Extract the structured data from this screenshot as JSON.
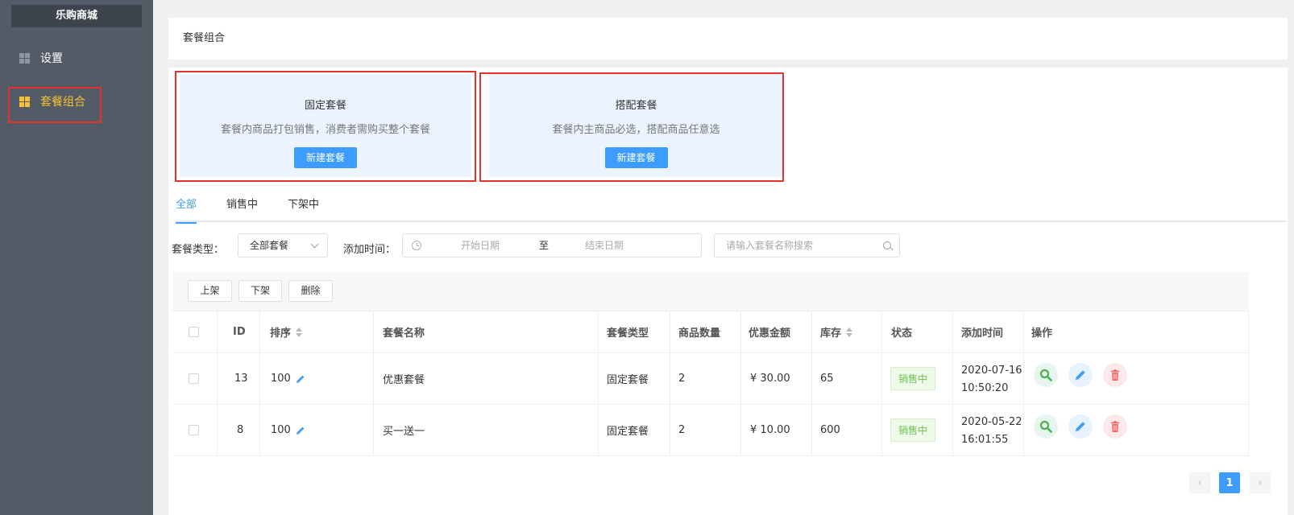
{
  "app": {
    "brand": "乐购商城"
  },
  "sidebar": {
    "items": [
      {
        "label": "设置",
        "icon": "grid-icon",
        "active": false
      },
      {
        "label": "套餐组合",
        "icon": "grid-icon",
        "active": true
      }
    ]
  },
  "header": {
    "title": "套餐组合"
  },
  "cards": [
    {
      "title": "固定套餐",
      "desc": "套餐内商品打包销售，消费者需购买整个套餐",
      "button": "新建套餐"
    },
    {
      "title": "搭配套餐",
      "desc": "套餐内主商品必选，搭配商品任意选",
      "button": "新建套餐"
    }
  ],
  "tabs": [
    {
      "label": "全部",
      "active": true
    },
    {
      "label": "销售中",
      "active": false
    },
    {
      "label": "下架中",
      "active": false
    }
  ],
  "filters": {
    "type_label": "套餐类型：",
    "type_value": "全部套餐",
    "time_label": "添加时间：",
    "date_start_placeholder": "开始日期",
    "date_separator": "至",
    "date_end_placeholder": "结束日期",
    "search_placeholder": "请输入套餐名称搜索"
  },
  "toolbar": {
    "on_shelf": "上架",
    "off_shelf": "下架",
    "delete": "删除"
  },
  "table": {
    "columns": [
      "ID",
      "排序",
      "套餐名称",
      "套餐类型",
      "商品数量",
      "优惠金额",
      "库存",
      "状态",
      "添加时间",
      "操作"
    ],
    "rows": [
      {
        "id": "13",
        "sort": "100",
        "name": "优惠套餐",
        "type": "固定套餐",
        "count": "2",
        "discount": "¥ 30.00",
        "stock": "65",
        "status": "销售中",
        "added": "2020-07-16 10:50:20"
      },
      {
        "id": "8",
        "sort": "100",
        "name": "买一送一",
        "type": "固定套餐",
        "count": "2",
        "discount": "¥ 10.00",
        "stock": "600",
        "status": "销售中",
        "added": "2020-05-22 16:01:55"
      }
    ]
  },
  "pagination": {
    "current": "1",
    "prev": "‹",
    "next": "›"
  },
  "colors": {
    "accent": "#3c9cff",
    "sidebar": "#535b66",
    "active_nav": "#f6c233",
    "highlight": "#e5322d",
    "status_green": "#6cc24a"
  }
}
